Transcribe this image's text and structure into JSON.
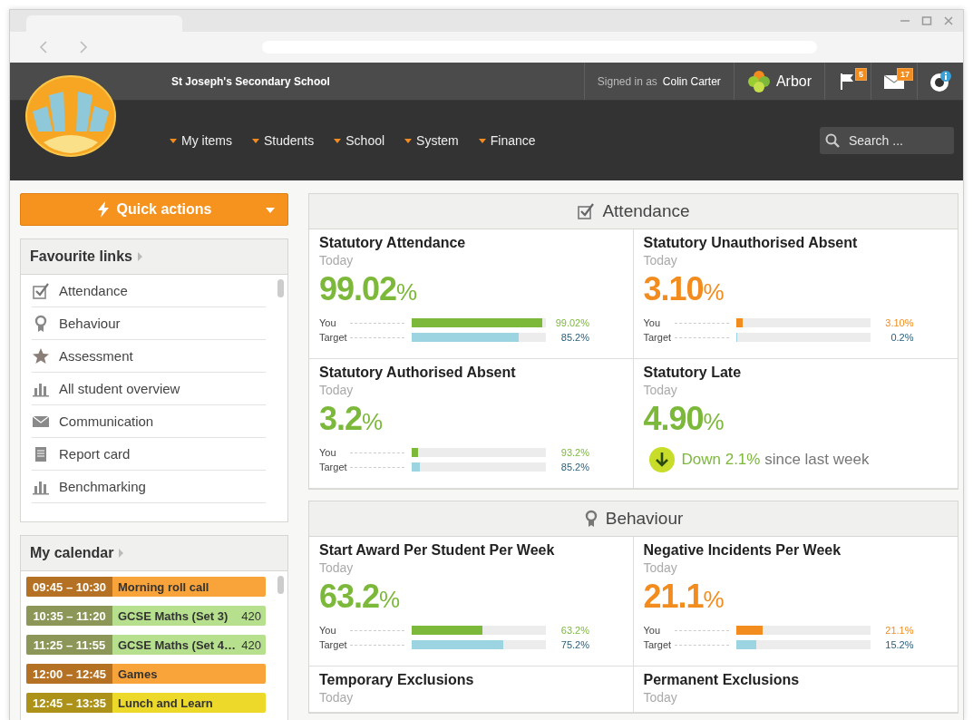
{
  "header": {
    "school": "St Joseph's Secondary School",
    "signed_in_label": "Signed in as",
    "user": "Colin Carter",
    "brand": "Arbor",
    "flag_count": "5",
    "mail_count": "17",
    "search": {
      "placeholder": "Search ..."
    },
    "nav": [
      "My items",
      "Students",
      "School",
      "System",
      "Finance"
    ]
  },
  "quick_actions": "Quick actions",
  "favourite_links": {
    "title": "Favourite links",
    "items": [
      {
        "label": "Attendance",
        "kind": "check"
      },
      {
        "label": "Behaviour",
        "kind": "award"
      },
      {
        "label": "Assessment",
        "kind": "star"
      },
      {
        "label": "All student overview",
        "kind": "bars"
      },
      {
        "label": "Communication",
        "kind": "mail"
      },
      {
        "label": "Report card",
        "kind": "doc"
      },
      {
        "label": "Benchmarking",
        "kind": "bars"
      }
    ]
  },
  "calendar": {
    "title": "My calendar",
    "events": [
      {
        "time": "09:45 – 10:30",
        "title": "Morning roll call",
        "color": "#f8a43a"
      },
      {
        "time": "10:35 – 11:20",
        "title": "GCSE Maths (Set 3)",
        "room": "420",
        "color": "#b6e08e"
      },
      {
        "time": "11:25 – 11:55",
        "title": "GCSE Maths (Set 4…",
        "room": "420",
        "color": "#b6e08e"
      },
      {
        "time": "12:00 – 12:45",
        "title": "Games",
        "color": "#f8a43a"
      },
      {
        "time": "12:45 – 13:35",
        "title": "Lunch and Learn",
        "color": "#ecd92a"
      }
    ]
  },
  "sections": [
    {
      "title": "Attendance",
      "kind": "check",
      "cards": [
        {
          "kind": "bars",
          "title": "Statutory Attendance",
          "period": "Today",
          "value": "99.02",
          "unit": "%",
          "color": "#7cb83a",
          "bars": [
            {
              "label": "You",
              "level": 0.97,
              "reading": "99.02%"
            },
            {
              "label": "Target",
              "level": 0.8,
              "reading": "85.2%"
            }
          ]
        },
        {
          "kind": "bars",
          "title": "Statutory Unauthorised Absent",
          "period": "Today",
          "value": "3.10",
          "unit": "%",
          "color": "#f28c1e",
          "bars": [
            {
              "label": "You",
              "level": 0.05,
              "reading": "3.10%"
            },
            {
              "label": "Target",
              "level": 0.01,
              "reading": "0.2%"
            }
          ]
        },
        {
          "kind": "bars",
          "title": "Statutory Authorised Absent",
          "period": "Today",
          "value": "3.2",
          "unit": "%",
          "color": "#7cb83a",
          "bars": [
            {
              "label": "You",
              "level": 0.05,
              "reading": "93.2%"
            },
            {
              "label": "Target",
              "level": 0.06,
              "reading": "85.2%"
            }
          ]
        },
        {
          "kind": "trend",
          "title": "Statutory Late",
          "period": "Today",
          "value": "4.90",
          "unit": "%",
          "color": "#7cb83a",
          "change": "Down 2.1%",
          "change_suffix": "since last week"
        }
      ]
    },
    {
      "title": "Behaviour",
      "kind": "award",
      "cards": [
        {
          "kind": "bars",
          "title": "Start Award Per Student Per Week",
          "period": "Today",
          "value": "63.2",
          "unit": "%",
          "color": "#7cb83a",
          "bars": [
            {
              "label": "You",
              "level": 0.53,
              "reading": "63.2%"
            },
            {
              "label": "Target",
              "level": 0.68,
              "reading": "75.2%"
            }
          ]
        },
        {
          "kind": "bars",
          "title": "Negative Incidents Per Week",
          "period": "Today",
          "value": "21.1",
          "unit": "%",
          "color": "#f28c1e",
          "bars": [
            {
              "label": "You",
              "level": 0.2,
              "reading": "21.1%"
            },
            {
              "label": "Target",
              "level": 0.15,
              "reading": "15.2%"
            }
          ]
        },
        {
          "kind": "stub",
          "title": "Temporary Exclusions",
          "period": "Today"
        },
        {
          "kind": "stub",
          "title": "Permanent Exclusions",
          "period": "Today"
        }
      ]
    }
  ]
}
